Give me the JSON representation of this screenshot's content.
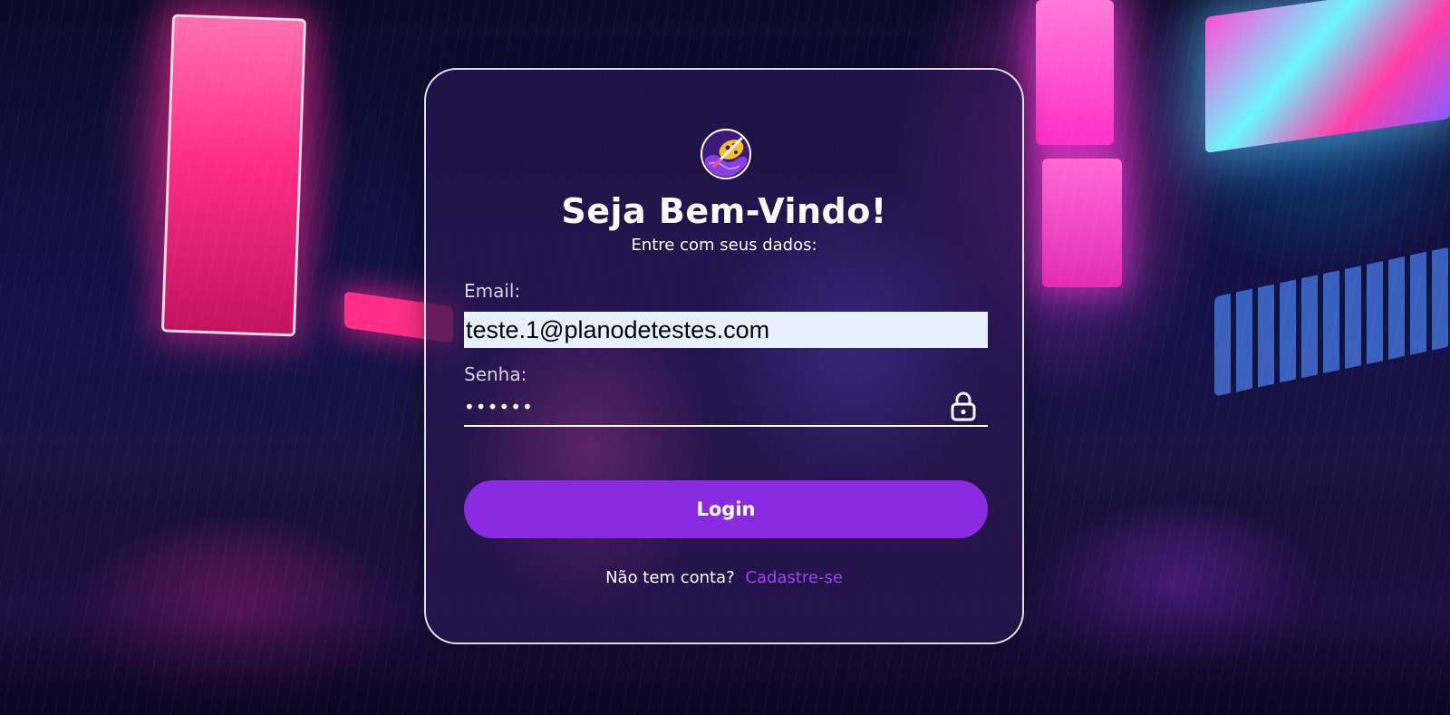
{
  "card": {
    "logo_icon": "palette-brush-icon",
    "title": "Seja Bem-Vindo!",
    "subtitle": "Entre com seus dados:"
  },
  "form": {
    "email_label": "Email:",
    "email_value": "teste.1@planodetestes.com",
    "password_label": "Senha:",
    "password_value": "123456",
    "password_icon": "lock-icon",
    "login_label": "Login"
  },
  "signup": {
    "prompt": "Não tem conta?",
    "link_label": "Cadastre-se"
  },
  "colors": {
    "accent": "#8a2be2",
    "link": "#9a44f0",
    "autofill_bg": "#e8f0fe"
  }
}
